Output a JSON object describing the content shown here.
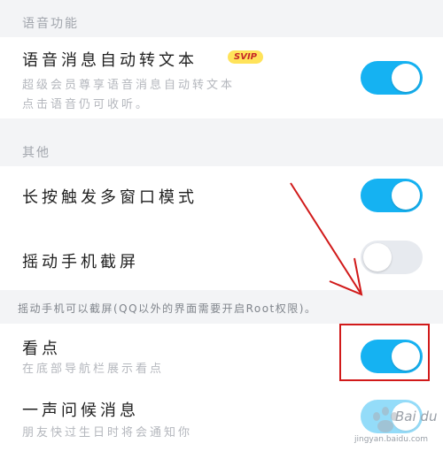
{
  "sections": {
    "voice": {
      "header": "语音功能",
      "item": {
        "title": "语音消息自动转文本",
        "badge": "SVIP",
        "desc_line1": "超级会员尊享语音消息自动转文本",
        "desc_line2": "点击语音仍可收听。",
        "toggle_on": true
      }
    },
    "other": {
      "header": "其他",
      "items": [
        {
          "title": "长按触发多窗口模式",
          "toggle_on": true
        },
        {
          "title": "摇动手机截屏",
          "toggle_on": false
        }
      ],
      "note": "摇动手机可以截屏(QQ以外的界面需要开启Root权限)。"
    },
    "more": {
      "items": [
        {
          "title": "看点",
          "desc": "在底部导航栏展示看点",
          "toggle_on": true
        },
        {
          "title": "一声问候消息",
          "desc": "朋友快过生日时将会通知你",
          "toggle_on": true
        }
      ]
    }
  },
  "watermark": {
    "brand": "Bai du",
    "sub": "jingyan.baidu.com"
  },
  "colors": {
    "toggle_on": "#15b2f2",
    "toggle_off": "#e7eaef",
    "annotation": "#d11a1a",
    "badge_bg": "#ffe35a"
  }
}
